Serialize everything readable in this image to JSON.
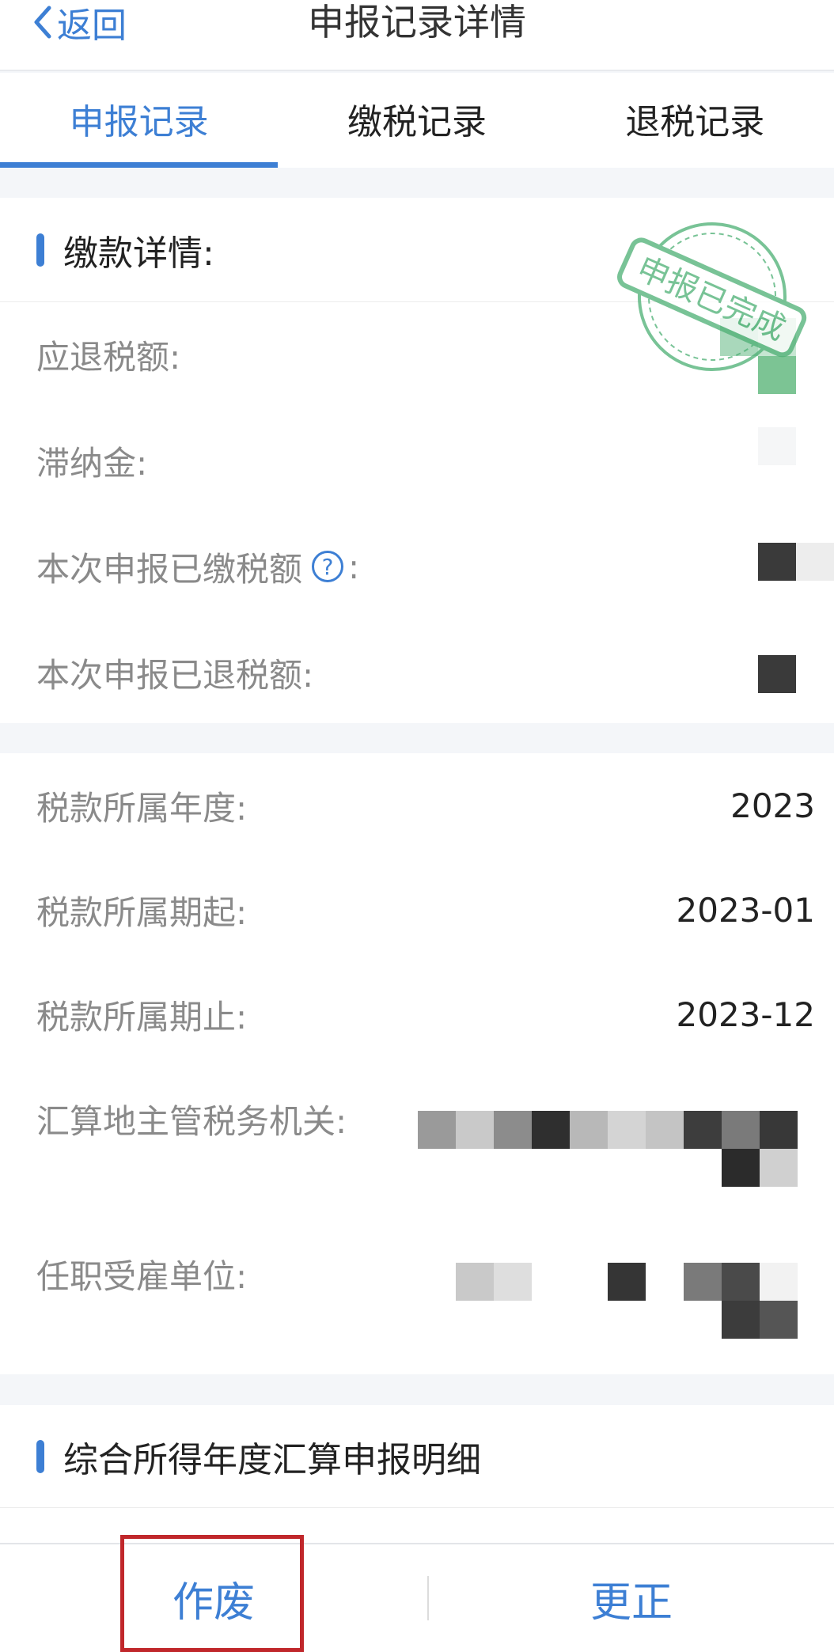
{
  "header": {
    "back_label": "返回",
    "title": "申报记录详情"
  },
  "tabs": [
    {
      "label": "申报记录"
    },
    {
      "label": "缴税记录"
    },
    {
      "label": "退税记录"
    }
  ],
  "payment_section": {
    "title": "缴款详情:",
    "stamp_text": "申报已完成",
    "rows": [
      {
        "label": "应退税额:"
      },
      {
        "label": "滞纳金:"
      },
      {
        "label": "本次申报已缴税额",
        "suffix": ":"
      },
      {
        "label": "本次申报已退税额:"
      }
    ]
  },
  "info_section": {
    "rows": [
      {
        "label": "税款所属年度:",
        "value": "2023"
      },
      {
        "label": "税款所属期起:",
        "value": "2023-01"
      },
      {
        "label": "税款所属期止:",
        "value": "2023-12"
      },
      {
        "label": "汇算地主管税务机关:"
      },
      {
        "label": "任职受雇单位:"
      }
    ]
  },
  "detail_section": {
    "title": "综合所得年度汇算申报明细"
  },
  "bottom": {
    "void_label": "作废",
    "correct_label": "更正"
  },
  "colors": {
    "accent": "#3d7fd4",
    "highlight": "#c0272b",
    "stamp": "#4caf73"
  }
}
